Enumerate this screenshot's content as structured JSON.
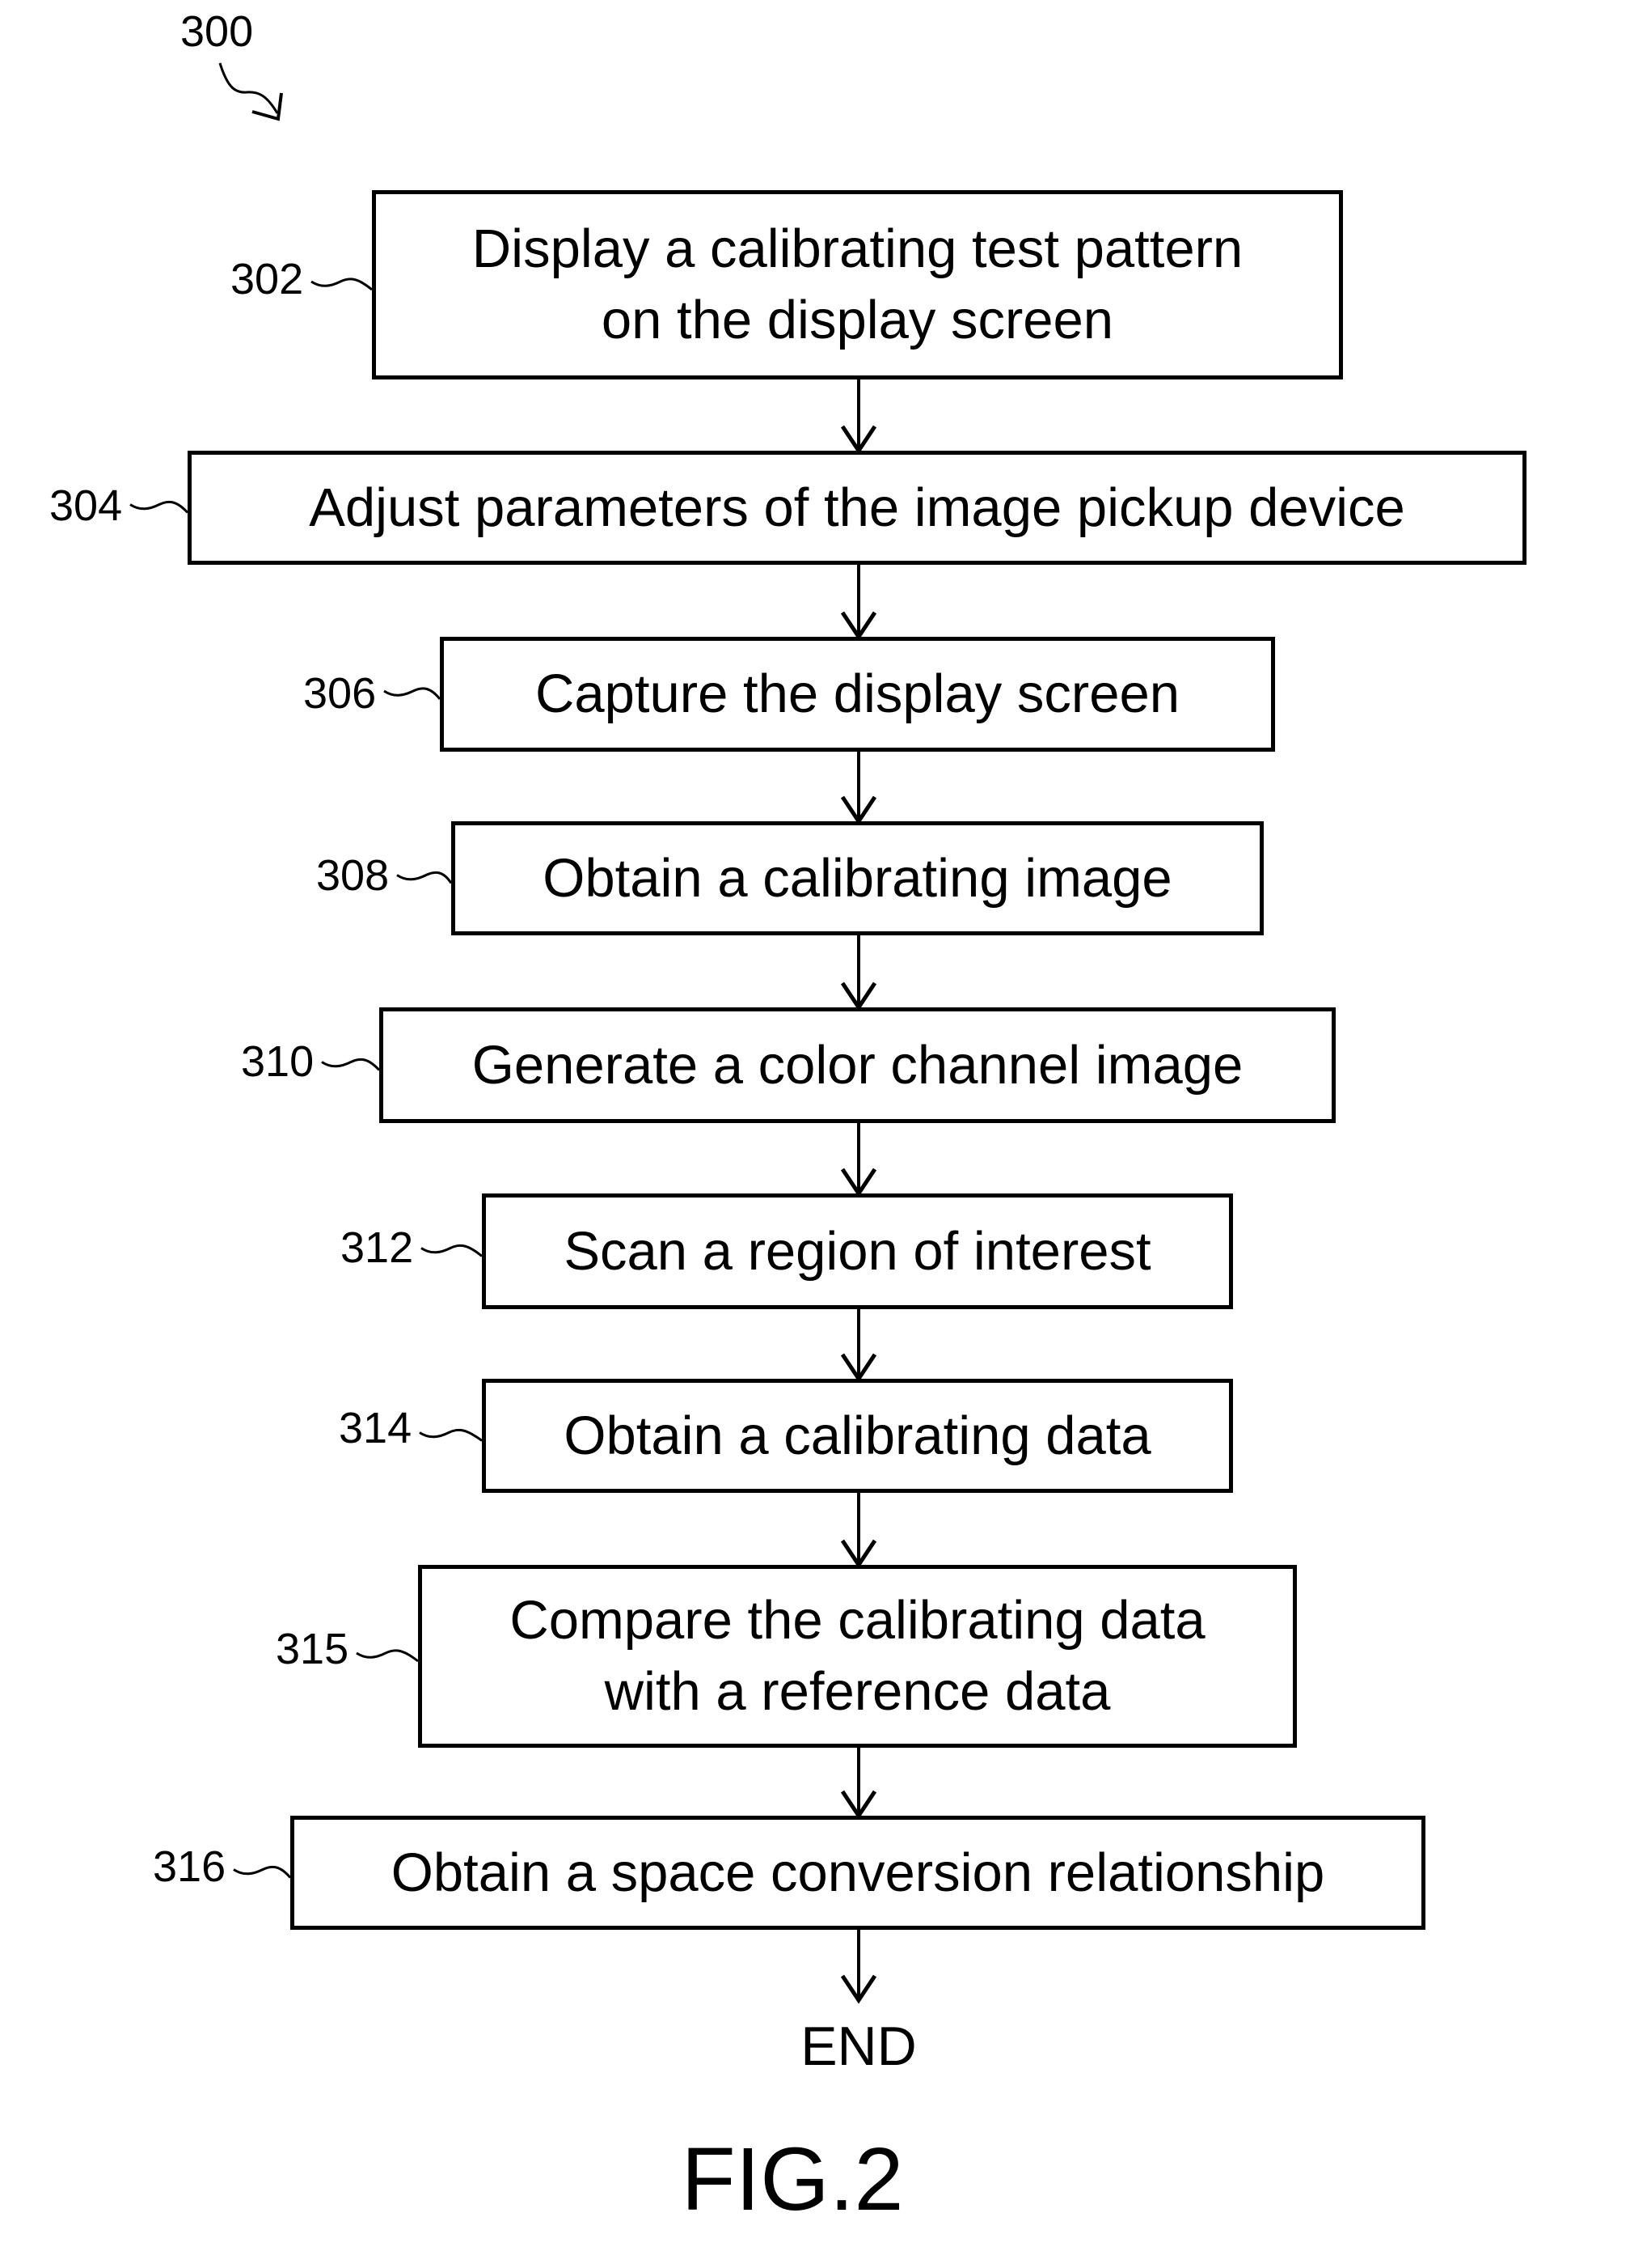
{
  "figure": {
    "reference": "300",
    "caption": "FIG.2",
    "end_label": "END"
  },
  "steps": [
    {
      "ref": "302",
      "text": "Display a calibrating test pattern\non the display screen"
    },
    {
      "ref": "304",
      "text": "Adjust parameters of the image pickup device"
    },
    {
      "ref": "306",
      "text": "Capture the display screen"
    },
    {
      "ref": "308",
      "text": "Obtain a calibrating image"
    },
    {
      "ref": "310",
      "text": "Generate a color channel image"
    },
    {
      "ref": "312",
      "text": "Scan a region of interest"
    },
    {
      "ref": "314",
      "text": "Obtain a calibrating data"
    },
    {
      "ref": "315",
      "text": "Compare the calibrating data\nwith a reference data"
    },
    {
      "ref": "316",
      "text": "Obtain a space conversion relationship"
    }
  ]
}
